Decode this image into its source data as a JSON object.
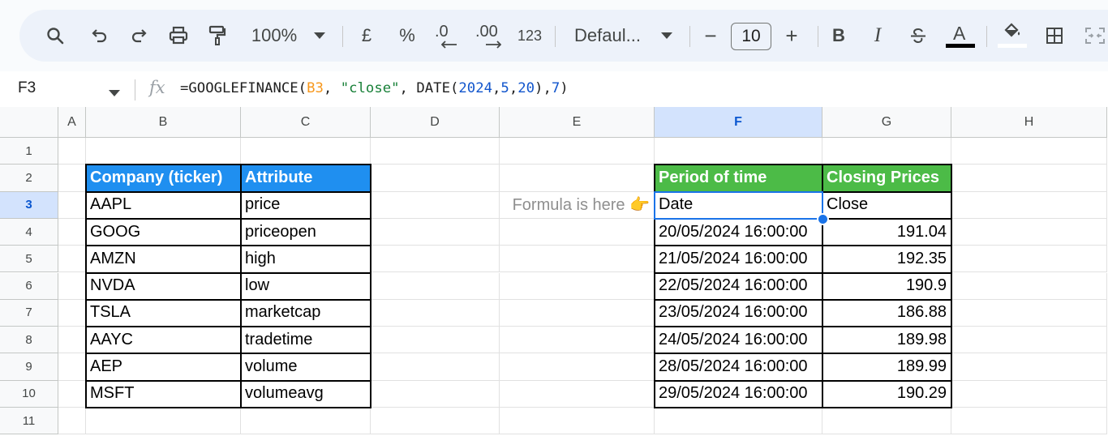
{
  "toolbar": {
    "zoom": "100%",
    "currency": "£",
    "percent": "%",
    "dec_decrease": ".0",
    "dec_increase": ".00",
    "number_format": "123",
    "font": "Defaul...",
    "font_size": "10",
    "minus": "−",
    "plus": "+",
    "bold": "B",
    "italic": "I",
    "text_color_letter": "A"
  },
  "formula_bar": {
    "name_box": "F3",
    "fx": "fx",
    "formula_parts": [
      {
        "text": "=GOOGLEFINANCE(",
        "color": "#1f1f1f"
      },
      {
        "text": "B3",
        "color": "#f7981d"
      },
      {
        "text": ", ",
        "color": "#1f1f1f"
      },
      {
        "text": "\"close\"",
        "color": "#188038"
      },
      {
        "text": ", DATE(",
        "color": "#1f1f1f"
      },
      {
        "text": "2024",
        "color": "#1155cc"
      },
      {
        "text": ",",
        "color": "#1f1f1f"
      },
      {
        "text": "5",
        "color": "#1155cc"
      },
      {
        "text": ",",
        "color": "#1f1f1f"
      },
      {
        "text": "20",
        "color": "#1155cc"
      },
      {
        "text": "),",
        "color": "#1f1f1f"
      },
      {
        "text": "7",
        "color": "#1155cc"
      },
      {
        "text": ")",
        "color": "#1f1f1f"
      }
    ]
  },
  "columns": [
    "A",
    "B",
    "C",
    "D",
    "E",
    "F",
    "G",
    "H"
  ],
  "rows": [
    "1",
    "2",
    "3",
    "4",
    "5",
    "6",
    "7",
    "8",
    "9",
    "10",
    "11"
  ],
  "selected": {
    "column": "F",
    "row": "3"
  },
  "table1": {
    "headers": [
      "Company (ticker)",
      "Attribute"
    ],
    "rows": [
      [
        "AAPL",
        "price"
      ],
      [
        "GOOG",
        "priceopen"
      ],
      [
        "AMZN",
        "high"
      ],
      [
        "NVDA",
        "low"
      ],
      [
        "TSLA",
        "marketcap"
      ],
      [
        "AAYC",
        "tradetime"
      ],
      [
        "AEP",
        "volume"
      ],
      [
        "MSFT",
        "volumeavg"
      ]
    ]
  },
  "note": "Formula is here 👉",
  "table2": {
    "headers": [
      "Period of time",
      "Closing Prices"
    ],
    "subheaders": [
      "Date",
      "Close"
    ],
    "rows": [
      [
        "20/05/2024 16:00:00",
        "191.04"
      ],
      [
        "21/05/2024 16:00:00",
        "192.35"
      ],
      [
        "22/05/2024 16:00:00",
        "190.9"
      ],
      [
        "23/05/2024 16:00:00",
        "186.88"
      ],
      [
        "24/05/2024 16:00:00",
        "189.98"
      ],
      [
        "28/05/2024 16:00:00",
        "189.99"
      ],
      [
        "29/05/2024 16:00:00",
        "190.29"
      ]
    ]
  },
  "colors": {
    "header_blue": "#1f8ff0",
    "header_green": "#4cbb47",
    "selection": "#1a73e8"
  }
}
